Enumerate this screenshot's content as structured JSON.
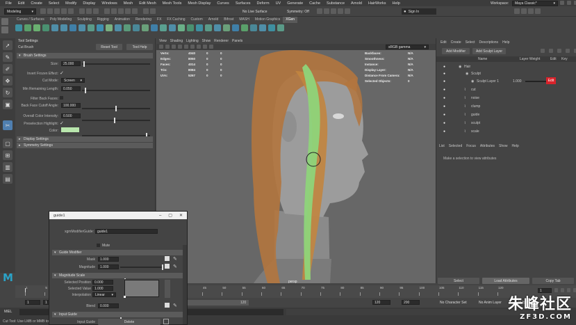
{
  "menubar": {
    "items": [
      "File",
      "Edit",
      "Create",
      "Select",
      "Modify",
      "Display",
      "Windows",
      "Mesh",
      "Edit Mesh",
      "Mesh Tools",
      "Mesh Display",
      "Curves",
      "Surfaces",
      "Deform",
      "UV",
      "Generate",
      "Cache",
      "Substance",
      "Arnold",
      "HairWorks",
      "Help"
    ],
    "workspace_label": "Workspace:",
    "workspace_value": "Maya Classic*"
  },
  "status": {
    "mode": "Modeling",
    "surface": "No Live Surface",
    "symmetry": "Symmetry: Off",
    "signin": "Sign In"
  },
  "shelf_tabs": [
    "Curves / Surfaces",
    "Poly Modeling",
    "Sculpting",
    "Rigging",
    "Animation",
    "Rendering",
    "FX",
    "FX Caching",
    "Custom",
    "Arnold",
    "Bifrost",
    "MASH",
    "Motion Graphics",
    "XGen"
  ],
  "shelf_active_index": 13,
  "tool_settings": {
    "panel_title": "Tool Settings",
    "tool_name": "Cut Brush",
    "reset_btn": "Reset Tool",
    "help_btn": "Tool Help",
    "brush_section": "Brush Settings",
    "size_label": "Size:",
    "size_value": "25.000",
    "invert_label": "Invert Frozen Effect:",
    "cutmode_label": "Cut Mode:",
    "cutmode_value": "Screen",
    "minlen_label": "Min Remaining Length:",
    "minlen_value": "0.050",
    "filterback_label": "Filter Back Faces:",
    "backcutoff_label": "Back Face Cutoff Angle:",
    "backcutoff_value": "100.000",
    "overall_label": "Overall Color Intensity:",
    "overall_value": "0.500",
    "preselect_label": "Preselection Highlight:",
    "color_label": "Color:",
    "display_section": "Display Settings",
    "symmetry_section": "Symmetry Settings"
  },
  "viewport": {
    "menus": [
      "View",
      "Shading",
      "Lighting",
      "Show",
      "Renderer",
      "Panels"
    ],
    "hud_labels": [
      "Verts:",
      "Edges:",
      "Faces:",
      "Tris:",
      "UVs:"
    ],
    "hud_values": [
      "4040",
      "8050",
      "4014",
      "8084",
      "5267"
    ],
    "hud_zero": "0",
    "hud_right_labels": [
      "Backfaces:",
      "Smoothness:",
      "Instance:",
      "Display Layer:",
      "Distance From Camera:",
      "Selected Objects:"
    ],
    "hud_right_values": [
      "N/A",
      "N/A",
      "N/A",
      "N/A",
      "N/A",
      "0"
    ],
    "colorspace": "sRGB gamma",
    "camera": "persp"
  },
  "outliner": {
    "menus": [
      "Edit",
      "Create",
      "Select",
      "Descriptions",
      "Help"
    ],
    "add_modifier": "Add Modifier",
    "add_sculpt_layer": "Add Sculpt Layer",
    "col_name": "Name",
    "col_weight": "Layer Weight",
    "col_edit": "Edit",
    "col_key": "Key",
    "items": [
      "Hair",
      "Sculpt",
      "Sculpt Layer 1",
      "cut",
      "noise",
      "clump",
      "guide",
      "sculpt",
      "scale"
    ],
    "layer_weight": "1.000",
    "edit_btn": "Edit"
  },
  "attr_editor": {
    "menus": [
      "List",
      "Selected",
      "Focus",
      "Attributes",
      "Show",
      "Help"
    ],
    "message": "Make a selection to view attributes",
    "select_btn": "Select",
    "load_btn": "Load Attributes",
    "copy_btn": "Copy Tab"
  },
  "dialog": {
    "title": "guide1",
    "modifier_label": "xgmModifierGuide:",
    "modifier_value": "guide1",
    "mute_label": "Mute",
    "guide_section": "Guide Modifier",
    "mask_label": "Mask",
    "mask_value": "1.000",
    "magnitude_label": "Magnitude",
    "magnitude_value": "1.000",
    "scale_section": "Magnitude Scale",
    "selpos_label": "Selected Position",
    "selpos_value": "0.000",
    "selval_label": "Selected Value",
    "selval_value": "1.000",
    "interp_label": "Interpolation",
    "interp_value": "Linear",
    "blend_label": "Blend",
    "blend_value": "0.000",
    "input_section": "Input Guide",
    "inputguide_label": "Input Guide",
    "delete_btn": "Delete"
  },
  "timeline": {
    "ticks": [
      "1",
      "5",
      "10",
      "15",
      "20",
      "25",
      "30",
      "35",
      "40",
      "45",
      "50",
      "55",
      "60",
      "65",
      "70",
      "75",
      "80",
      "85",
      "90",
      "95",
      "100",
      "105",
      "110",
      "115",
      "120"
    ],
    "current": "1"
  },
  "range": {
    "start": "1",
    "start2": "1",
    "end_inner": "120",
    "end_outer": "120",
    "end_max": "200",
    "char_set": "No Character Set",
    "anim_layer": "No Anim Layer",
    "fps": "24 fps"
  },
  "cmd": {
    "lang": "MEL"
  },
  "help_line": "Cut Tool: Use LMB or MMB to cut...",
  "watermark": {
    "cn": "朱峰社区",
    "site": "ZF3D.COM"
  },
  "colors": {
    "accent": "#4f7fb0",
    "hair": "#b3753e",
    "guide": "#8ed47a",
    "edit_red": "#d9232b"
  }
}
